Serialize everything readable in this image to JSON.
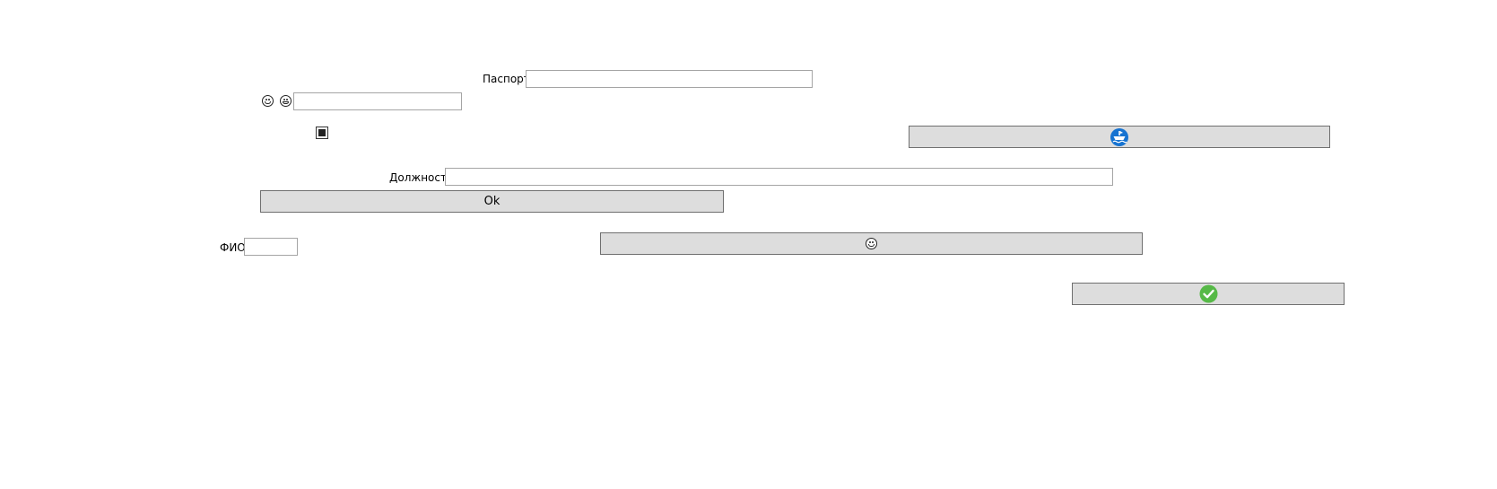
{
  "form": {
    "passport_label": "Паспорт",
    "passport_value": "",
    "faces_field_value": "",
    "position_label": "Должность",
    "position_value": "",
    "fio_label": "ФИО",
    "fio_value": "",
    "checkbox_checked": true
  },
  "buttons": {
    "ok_label": "Ok",
    "ship_button_icon": "ship-icon",
    "smiley_button_icon": "grinning-face-icon",
    "confirm_button_icon": "check-circle-icon"
  },
  "colors": {
    "button_bg": "#dddddd",
    "ship_blue": "#1673d1",
    "check_green": "#56b947"
  }
}
